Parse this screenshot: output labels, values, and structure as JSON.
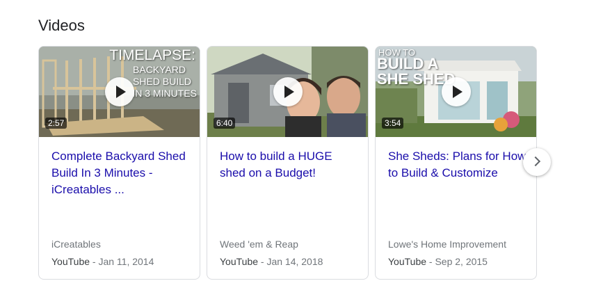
{
  "section": {
    "title": "Videos"
  },
  "cards": [
    {
      "title": "Complete Backyard Shed Build In 3 Minutes - iCreatables ...",
      "duration": "2:57",
      "channel": "iCreatables",
      "platform": "YouTube",
      "date": " - Jan 11, 2014",
      "thumb_text": [
        "TIMELAPSE:",
        "BACKYARD",
        "SHED BUILD",
        "IN 3 MINUTES"
      ]
    },
    {
      "title": "How to build a HUGE shed on a Budget!",
      "duration": "6:40",
      "channel": "Weed 'em & Reap",
      "platform": "YouTube",
      "date": " - Jan 14, 2018"
    },
    {
      "title": "She Sheds: Plans for How to Build & Customize",
      "duration": "3:54",
      "channel": "Lowe's Home Improvement",
      "platform": "YouTube",
      "date": " - Sep 2, 2015",
      "thumb_text": [
        "HOW TO",
        "BUILD A",
        "SHE SHED"
      ]
    }
  ],
  "icons": {
    "play": "play-icon",
    "next": "chevron-right-icon"
  }
}
